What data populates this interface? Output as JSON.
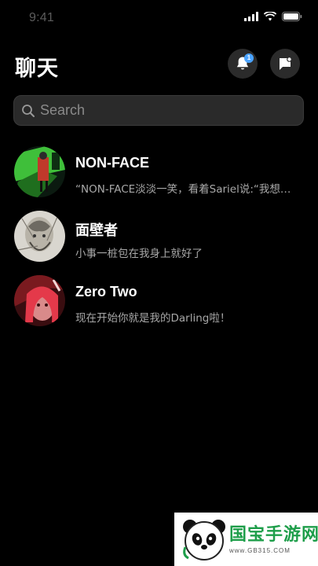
{
  "status_bar": {
    "time": "9:41"
  },
  "header": {
    "title": "聊天",
    "notification_count": "1"
  },
  "search": {
    "placeholder": "Search"
  },
  "chats": [
    {
      "name": "NON-FACE",
      "preview": "“NON-FACE淡淡一笑，看着Sariel说:“我想…",
      "avatar": "green-dark-artwork"
    },
    {
      "name": "面壁者",
      "preview": "小事一桩包在我身上就好了",
      "avatar": "sketch-portrait"
    },
    {
      "name": "Zero Two",
      "preview": "现在开始你就是我的Darling啦！",
      "avatar": "red-anime-portrait"
    }
  ],
  "watermark": {
    "text": "国宝手游网",
    "url": "www.GB315.COM"
  },
  "colors": {
    "background": "#000000",
    "surface": "#2a2a2a",
    "badge": "#4aa3ff",
    "watermark_green": "#1e9e4a"
  }
}
